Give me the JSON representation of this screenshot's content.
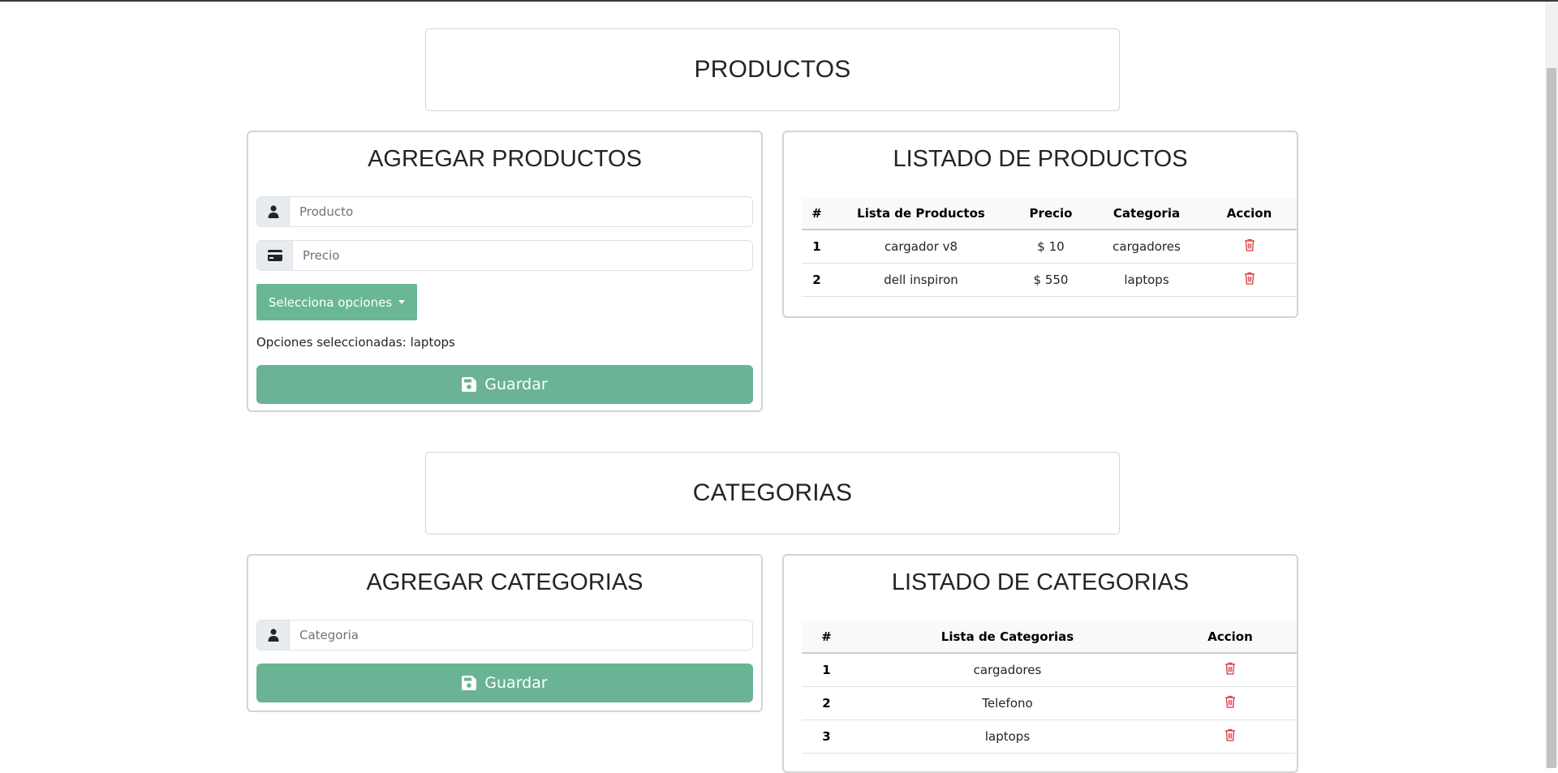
{
  "productos_section": {
    "title": "PRODUCTOS",
    "form": {
      "title": "AGREGAR PRODUCTOS",
      "product_placeholder": "Producto",
      "price_placeholder": "Precio",
      "dropdown_label": "Selecciona opciones",
      "selected_text": "Opciones seleccionadas: laptops",
      "save_label": "Guardar"
    },
    "list": {
      "title": "LISTADO DE PRODUCTOS",
      "columns": [
        "#",
        "Lista de Productos",
        "Precio",
        "Categoria",
        "Accion"
      ],
      "rows": [
        {
          "num": "1",
          "name": "cargador v8",
          "price": "$ 10",
          "category": "cargadores"
        },
        {
          "num": "2",
          "name": "dell inspiron",
          "price": "$ 550",
          "category": "laptops"
        }
      ]
    }
  },
  "categorias_section": {
    "title": "CATEGORIAS",
    "form": {
      "title": "AGREGAR CATEGORIAS",
      "category_placeholder": "Categoria",
      "save_label": "Guardar"
    },
    "list": {
      "title": "LISTADO DE CATEGORIAS",
      "columns": [
        "#",
        "Lista de Categorias",
        "Accion"
      ],
      "rows": [
        {
          "num": "1",
          "name": "cargadores"
        },
        {
          "num": "2",
          "name": "Telefono"
        },
        {
          "num": "3",
          "name": "laptops"
        }
      ]
    }
  },
  "icons": {
    "user": "user-icon",
    "card": "credit-card-icon",
    "save": "floppy-disk-icon",
    "trash": "trash-icon",
    "caret": "caret-down-icon"
  },
  "colors": {
    "accent_green": "#6ab395",
    "danger_red": "#dc3545"
  }
}
